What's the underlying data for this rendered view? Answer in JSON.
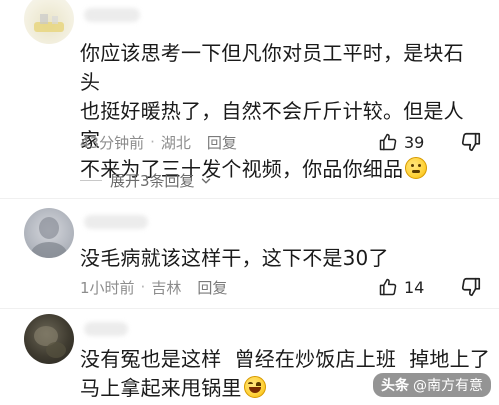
{
  "comments": [
    {
      "text_lines": [
        "你应该思考一下但凡你对员工平时，是块石头",
        "也挺好暖热了，自然不会斤斤计较。但是人家",
        "不来为了三十发个视频，你品你细品"
      ],
      "emoji_icon": "thinking-face-icon",
      "time": "43分钟前",
      "location": "湖北",
      "reply_label": "回复",
      "likes": "39"
    },
    {
      "text_lines": [
        "没毛病就该这样干，这下不是30了"
      ],
      "time": "1小时前",
      "location": "吉林",
      "reply_label": "回复",
      "likes": "14"
    },
    {
      "text_lines": [
        "没有冤也是这样  曾经在炒饭店上班  掉地上了",
        "马上拿起来甩锅里"
      ],
      "emoji_icon": "laughing-tears-icon"
    }
  ],
  "expand_replies": {
    "label": "展开3条回复",
    "icon": "chevron-down-icon"
  },
  "separator": "·",
  "watermark": {
    "brand": "头条",
    "handle": "@南方有意"
  },
  "colors": {
    "meta_text": "#8d8d8d",
    "body_text": "#1a1a1a",
    "background": "#ffffff"
  }
}
